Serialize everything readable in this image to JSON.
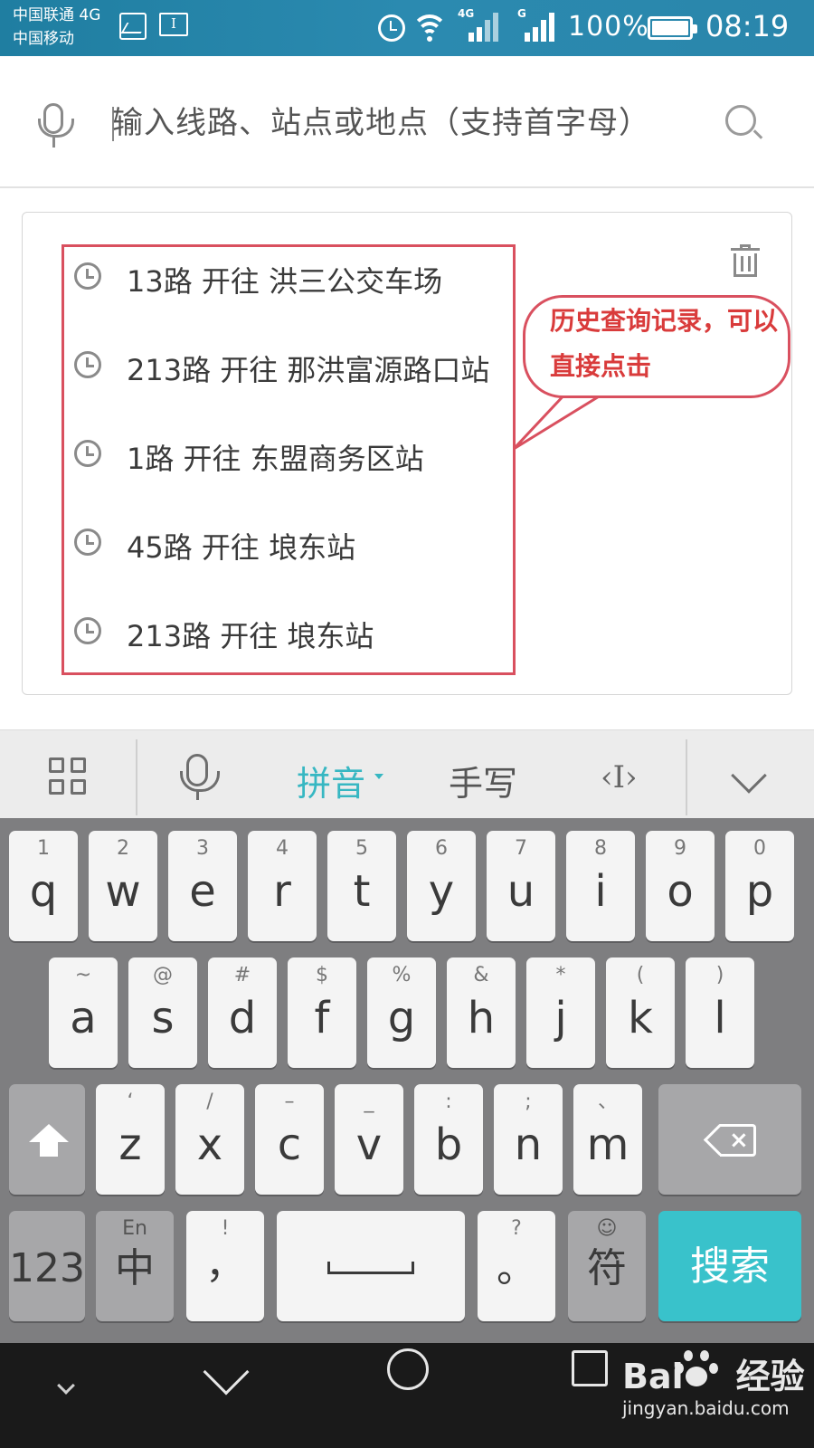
{
  "status_bar": {
    "carrier_1": "中国联通 4G",
    "carrier_2": "中国移动",
    "text_icon": "I",
    "net_1": "4G",
    "net_2": "G",
    "battery": "100%",
    "time": "08:19"
  },
  "search": {
    "placeholder": "输入线路、站点或地点（支持首字母）",
    "mic_icon": "mic-icon",
    "search_icon": "search-icon"
  },
  "history": {
    "items": [
      {
        "label": "13路 开往 洪三公交车场"
      },
      {
        "label": "213路 开往 那洪富源路口站"
      },
      {
        "label": "1路 开往 东盟商务区站"
      },
      {
        "label": "45路 开往 埌东站"
      },
      {
        "label": "213路 开往 埌东站"
      }
    ],
    "annotation": "历史查询记录，可以直接点击",
    "annotation_color": "#d93b3b",
    "highlight_color": "#d9505f"
  },
  "keyboard": {
    "toolbar": {
      "pinyin": "拼音",
      "handwrite": "手写",
      "cursor": "‹I›",
      "accent": "#37b7c2"
    },
    "row1": [
      {
        "hint": "1",
        "key": "q"
      },
      {
        "hint": "2",
        "key": "w"
      },
      {
        "hint": "3",
        "key": "e"
      },
      {
        "hint": "4",
        "key": "r"
      },
      {
        "hint": "5",
        "key": "t"
      },
      {
        "hint": "6",
        "key": "y"
      },
      {
        "hint": "7",
        "key": "u"
      },
      {
        "hint": "8",
        "key": "i"
      },
      {
        "hint": "9",
        "key": "o"
      },
      {
        "hint": "0",
        "key": "p"
      }
    ],
    "row2": [
      {
        "hint": "~",
        "key": "a"
      },
      {
        "hint": "@",
        "key": "s"
      },
      {
        "hint": "#",
        "key": "d"
      },
      {
        "hint": "$",
        "key": "f"
      },
      {
        "hint": "%",
        "key": "g"
      },
      {
        "hint": "&",
        "key": "h"
      },
      {
        "hint": "*",
        "key": "j"
      },
      {
        "hint": "(",
        "key": "k"
      },
      {
        "hint": ")",
        "key": "l"
      }
    ],
    "row3": [
      {
        "hint": "‘",
        "key": "z"
      },
      {
        "hint": "/",
        "key": "x"
      },
      {
        "hint": "–",
        "key": "c"
      },
      {
        "hint": "_",
        "key": "v"
      },
      {
        "hint": ":",
        "key": "b"
      },
      {
        "hint": ";",
        "key": "n"
      },
      {
        "hint": "、",
        "key": "m"
      }
    ],
    "bottom": {
      "num": "123",
      "lang_hint": "En",
      "lang": "中",
      "comma_hint": "!",
      "comma": "，",
      "period_hint": "?",
      "period": "。",
      "symbol_hint": "☺",
      "symbol": "符",
      "search": "搜索",
      "search_color": "#39c2cb"
    }
  },
  "watermark": {
    "logo": "Bai",
    "logo_suffix": "经验",
    "url": "jingyan.baidu.com"
  }
}
